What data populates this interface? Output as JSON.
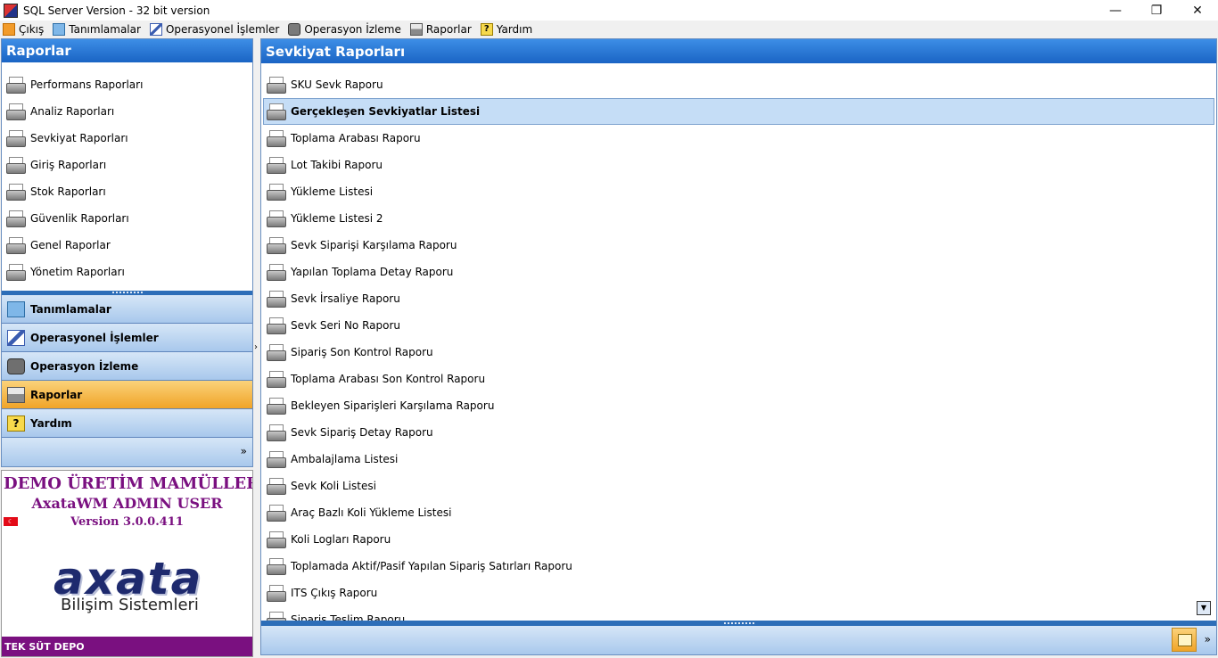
{
  "window": {
    "title": "SQL Server Version - 32 bit version"
  },
  "menubar": [
    {
      "label": "Çıkış",
      "icon": "exit-icon"
    },
    {
      "label": "Tanımlamalar",
      "icon": "keyboard-icon"
    },
    {
      "label": "Operasyonel İşlemler",
      "icon": "pencil-icon"
    },
    {
      "label": "Operasyon İzleme",
      "icon": "camera-icon"
    },
    {
      "label": "Raporlar",
      "icon": "printer-icon"
    },
    {
      "label": "Yardım",
      "icon": "help-icon"
    }
  ],
  "left_panel": {
    "header": "Raporlar",
    "items": [
      "Performans Raporları",
      "Analiz Raporları",
      "Sevkiyat Raporları",
      "Giriş Raporları",
      "Stok Raporları",
      "Güvenlik Raporları",
      "Genel Raporlar",
      "Yönetim Raporları"
    ],
    "nav": [
      {
        "label": "Tanımlamalar",
        "active": false
      },
      {
        "label": "Operasyonel İşlemler",
        "active": false
      },
      {
        "label": "Operasyon İzleme",
        "active": false
      },
      {
        "label": "Raporlar",
        "active": true
      },
      {
        "label": "Yardım",
        "active": false
      }
    ],
    "nav_overflow": "»"
  },
  "info": {
    "company": "DEMO ÜRETİM MAMÜLLERİ S",
    "user": "AxataWM ADMIN USER",
    "version": "Version 3.0.0.411",
    "logo": "axata",
    "logo_sub": "Bilişim Sistemleri",
    "depot": "TEK SÜT DEPO"
  },
  "right_panel": {
    "header": "Sevkiyat Raporları",
    "selected_index": 1,
    "items": [
      "SKU Sevk Raporu",
      "Gerçekleşen Sevkiyatlar Listesi",
      "Toplama Arabası Raporu",
      "Lot Takibi Raporu",
      "Yükleme Listesi",
      "Yükleme Listesi 2",
      "Sevk Siparişi Karşılama Raporu",
      "Yapılan Toplama Detay Raporu",
      "Sevk İrsaliye Raporu",
      "Sevk Seri No Raporu",
      "Sipariş Son Kontrol Raporu",
      "Toplama Arabası Son Kontrol Raporu",
      "Bekleyen Siparişleri Karşılama Raporu",
      "Sevk Sipariş Detay Raporu",
      "Ambalajlama Listesi",
      "Sevk Koli Listesi",
      "Araç Bazlı Koli Yükleme Listesi",
      "Koli Logları Raporu",
      "Toplamada Aktif/Pasif Yapılan Sipariş Satırları Raporu",
      "ITS Çıkış Raporu",
      "Sipariş Teslim Raporu"
    ],
    "footer_overflow": "»"
  },
  "colors": {
    "header_blue": "#1a64c4",
    "active_orange": "#f0a428",
    "brand_purple": "#7a1080"
  }
}
